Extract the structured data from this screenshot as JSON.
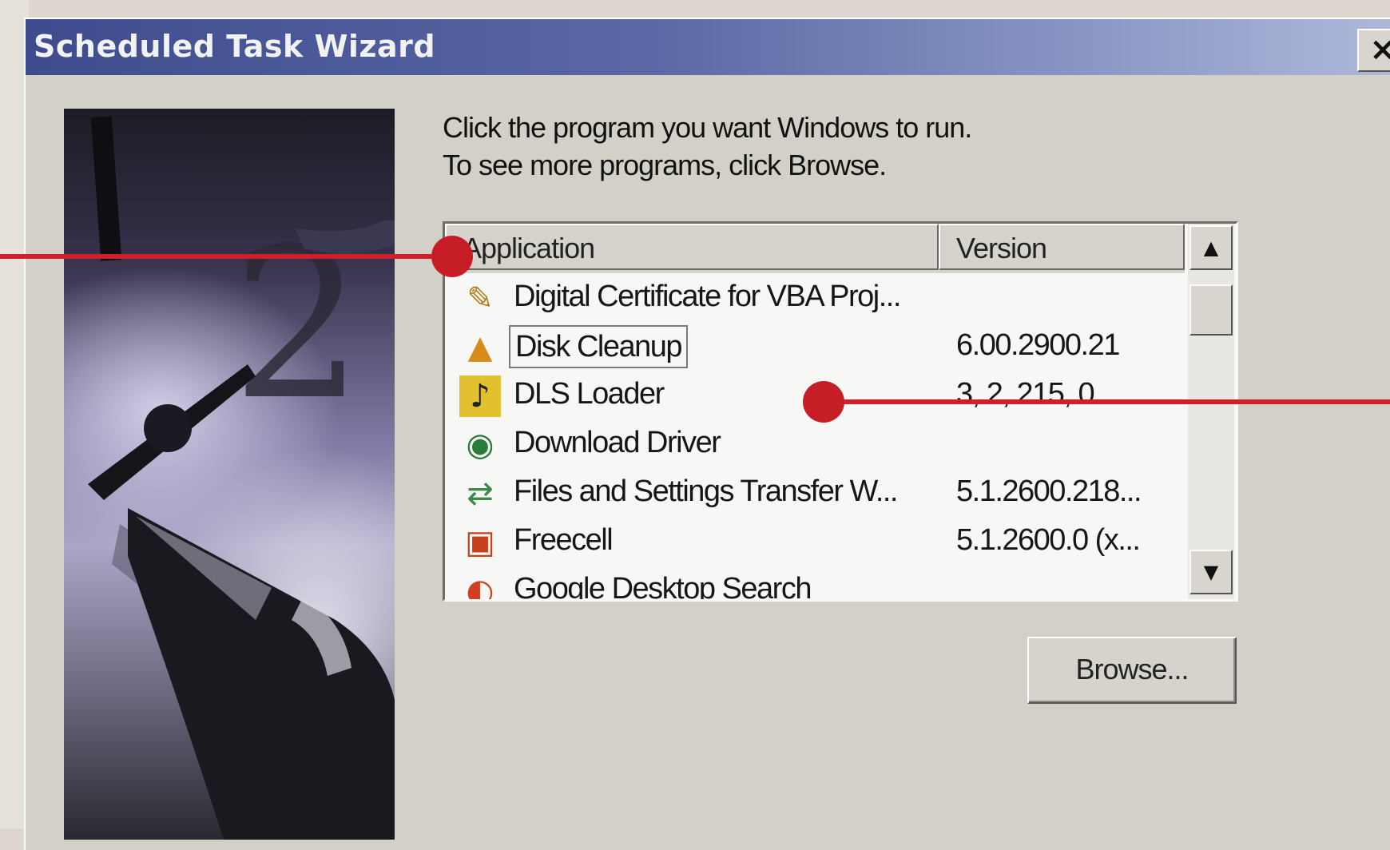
{
  "window": {
    "title": "Scheduled Task Wizard",
    "close_label": "×"
  },
  "instructions": {
    "line1": "Click the program you want Windows to run.",
    "line2": "To see more programs, click Browse."
  },
  "list": {
    "columns": [
      "Application",
      "Version"
    ],
    "rows": [
      {
        "name": "Digital Certificate for VBA Proj...",
        "version": "",
        "icon": "certificate-icon",
        "glyph": "✎"
      },
      {
        "name": "Disk Cleanup",
        "version": "6.00.2900.21",
        "icon": "disk-cleanup-icon",
        "glyph": "▲",
        "selected": true
      },
      {
        "name": "DLS Loader",
        "version": "3, 2, 215, 0",
        "icon": "music-note-icon",
        "glyph": "♪"
      },
      {
        "name": "Download Driver",
        "version": "",
        "icon": "download-driver-icon",
        "glyph": "◉"
      },
      {
        "name": "Files and Settings Transfer W...",
        "version": "5.1.2600.218...",
        "icon": "transfer-wizard-icon",
        "glyph": "⇄"
      },
      {
        "name": "Freecell",
        "version": "5.1.2600.0 (x...",
        "icon": "freecell-icon",
        "glyph": "▣"
      },
      {
        "name": "Google Desktop Search",
        "version": "",
        "icon": "google-desktop-icon",
        "glyph": "◐"
      }
    ],
    "scroll_up": "▲",
    "scroll_down": "▼"
  },
  "buttons": {
    "browse": "Browse..."
  },
  "colors": {
    "title_bar_start": "#3e4c8d",
    "callout": "#d01f2a",
    "dialog_face": "#d3d0c8"
  }
}
